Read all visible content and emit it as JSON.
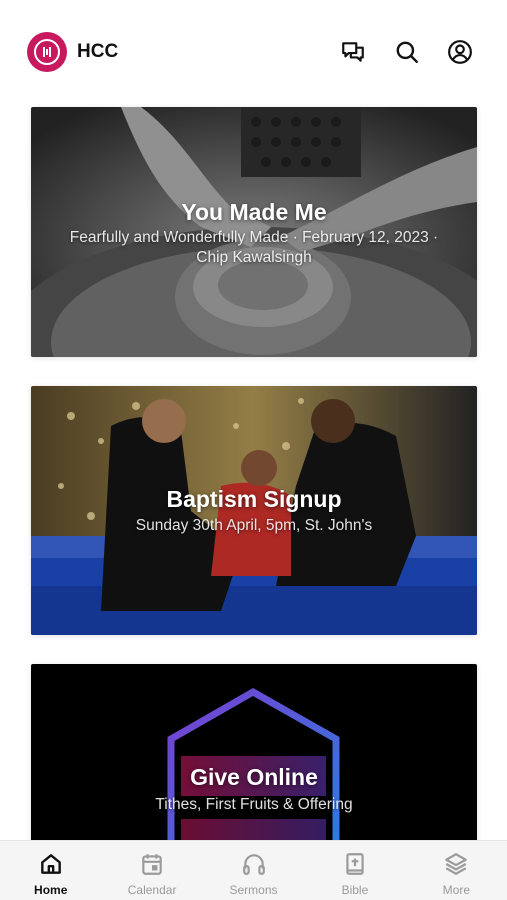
{
  "header": {
    "app_name": "HCC"
  },
  "cards": [
    {
      "title": "You Made Me",
      "subtitle": "Fearfully and Wonderfully Made · February 12, 2023 · Chip Kawalsingh"
    },
    {
      "title": "Baptism Signup",
      "subtitle": "Sunday 30th April, 5pm, St. John's"
    },
    {
      "title": "Give Online",
      "subtitle": "Tithes, First Fruits & Offering"
    }
  ],
  "tabs": [
    {
      "label": "Home",
      "icon": "home-icon",
      "active": true
    },
    {
      "label": "Calendar",
      "icon": "calendar-icon",
      "active": false
    },
    {
      "label": "Sermons",
      "icon": "headphones-icon",
      "active": false
    },
    {
      "label": "Bible",
      "icon": "bible-icon",
      "active": false
    },
    {
      "label": "More",
      "icon": "layers-icon",
      "active": false
    }
  ],
  "colors": {
    "brand": "#c8195f",
    "active_tab": "#111111",
    "inactive_tab": "#9a9a9a"
  }
}
